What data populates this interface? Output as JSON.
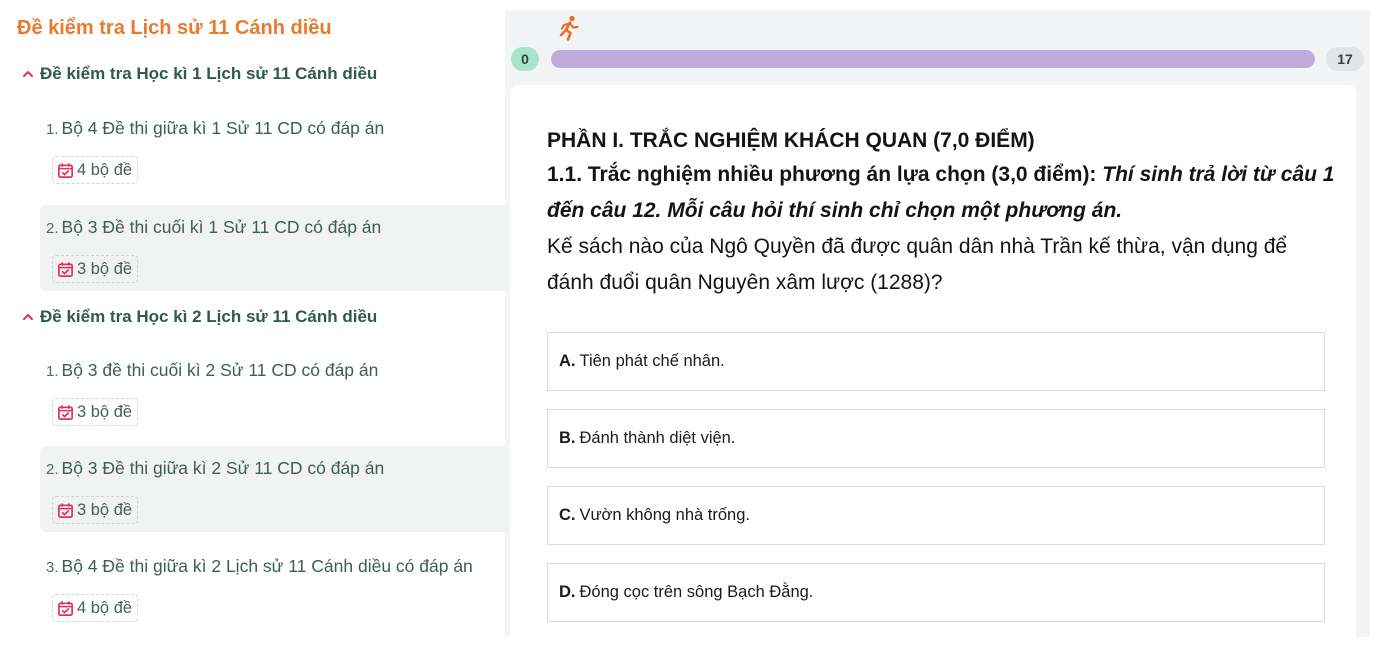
{
  "sidebar": {
    "title": "Đề kiểm tra Lịch sử 11 Cánh diều",
    "groups": [
      {
        "title": "Đề kiểm tra Học kì 1 Lịch sử 11 Cánh diều",
        "items": [
          {
            "num": "1.",
            "title": "Bộ 4 Đề thi giữa kì 1 Sử 11 CD có đáp án",
            "badge": "4 bộ đề"
          },
          {
            "num": "2.",
            "title": "Bộ 3 Đề thi cuối kì 1 Sử 11 CD có đáp án",
            "badge": "3 bộ đề"
          }
        ]
      },
      {
        "title": "Đề kiểm tra Học kì 2 Lịch sử 11 Cánh diều",
        "items": [
          {
            "num": "1.",
            "title": "Bộ 3 đề thi cuối kì 2 Sử 11 CD có đáp án",
            "badge": "3 bộ đề"
          },
          {
            "num": "2.",
            "title": "Bộ 3 Đề thi giữa kì 2 Sử 11 CD có đáp án",
            "badge": "3 bộ đề"
          },
          {
            "num": "3.",
            "title": "Bộ 4 Đề thi giữa kì 2 Lịch sử 11 Cánh diều có đáp án",
            "badge": "4 bộ đề"
          }
        ]
      }
    ]
  },
  "quiz": {
    "progress": {
      "start": "0",
      "end": "17",
      "fill_fraction": 1.0
    },
    "part_title": "PHẦN I. TRẮC NGHIỆM KHÁCH QUAN (7,0 ĐIỂM)",
    "section_title": "1.1. Trắc nghiệm nhiều phương án lựa chọn (3,0 điểm):",
    "section_instruction": "Thí sinh trả lời từ câu 1 đến câu 12. Mỗi câu hỏi thí sinh chỉ chọn một phương án.",
    "question": "Kế sách nào của Ngô Quyền đã được quân dân nhà Trần kế thừa, vận dụng để đánh đuổi quân Nguyên xâm lược (1288)?",
    "options": [
      {
        "letter": "A.",
        "text": "Tiên phát chế nhân."
      },
      {
        "letter": "B.",
        "text": "Đánh thành diệt viện."
      },
      {
        "letter": "C.",
        "text": "Vườn không nhà trống."
      },
      {
        "letter": "D.",
        "text": "Đóng cọc trên sông Bạch Đằng."
      }
    ]
  },
  "colors": {
    "accent_orange": "#ec7a2c",
    "sidebar_text": "#2f5b4a",
    "badge_icon": "#e0315a",
    "progress_fill": "#c0acdb",
    "start_pill": "#a8e3cb"
  },
  "icons": {
    "runner": "running-person-icon",
    "chevron": "chevron-up-icon",
    "badge": "calendar-check-icon"
  }
}
